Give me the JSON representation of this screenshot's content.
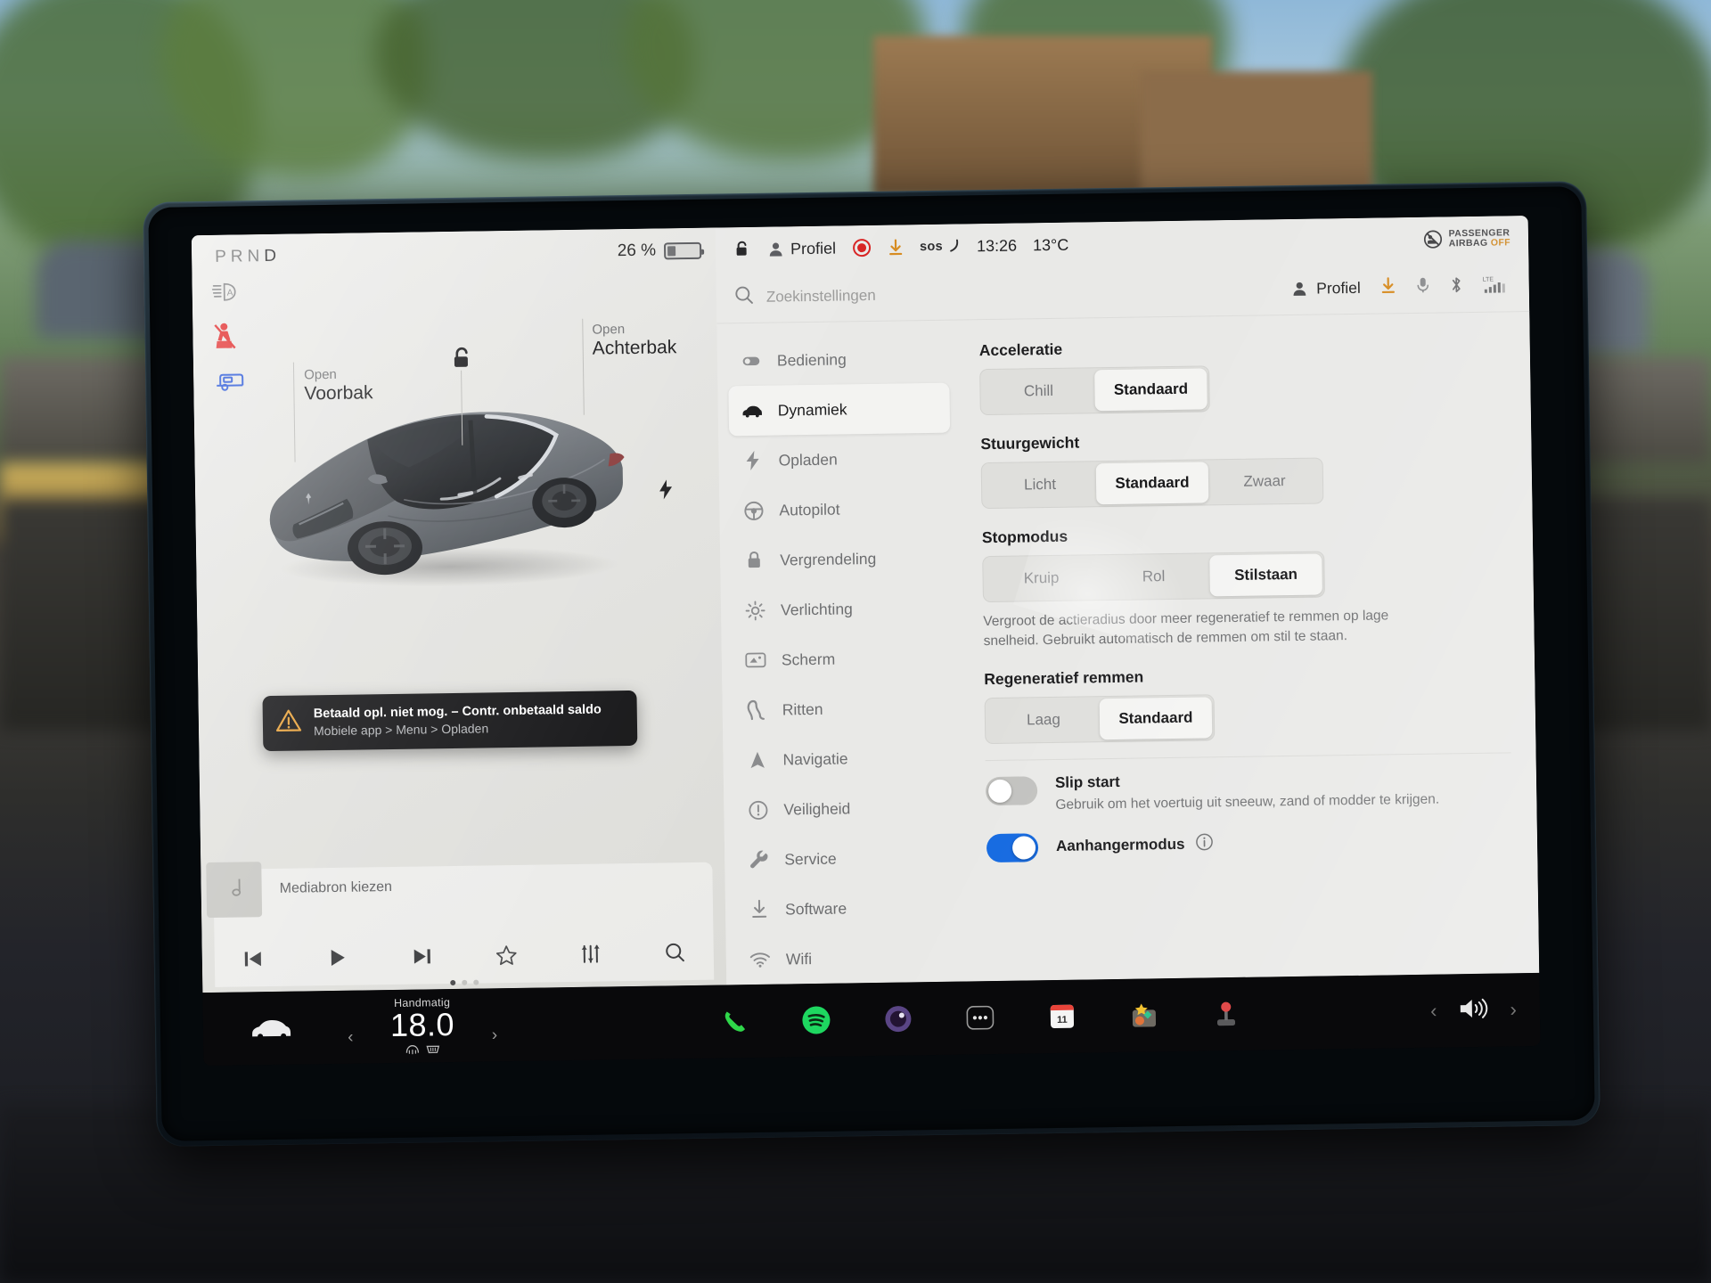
{
  "status_bar_left": {
    "gear_indicator": "PRND",
    "gear_active": "D",
    "battery_percent": "26 %",
    "battery_level": 26
  },
  "status_bar_right": {
    "profile_label": "Profiel",
    "sos_label": "sos",
    "time": "13:26",
    "temperature": "13°C",
    "airbag_line1": "PASSENGER",
    "airbag_line2": "AIRBAG",
    "airbag_state": "OFF",
    "icons": [
      "unlock-icon",
      "person-icon",
      "record-dot-icon",
      "download-icon",
      "sos-icon"
    ]
  },
  "indicators": [
    {
      "name": "auto-high-beam-icon",
      "color": "#7b7c7e"
    },
    {
      "name": "seatbelt-warning-icon",
      "color": "#e02424"
    },
    {
      "name": "trailer-mode-icon",
      "color": "#2756d8"
    }
  ],
  "car_view": {
    "front_trunk": {
      "action": "Open",
      "label": "Voorbak"
    },
    "rear_trunk": {
      "action": "Open",
      "label": "Achterbak"
    },
    "lock_state_icon": "unlock-icon",
    "charge_port_icon": "charge-bolt-icon",
    "car_color": "#6f7478"
  },
  "alert": {
    "icon": "warning-triangle-icon",
    "title": "Betaald opl. niet mog. – Contr. onbetaald saldo",
    "subtitle": "Mobiele app > Menu > Opladen"
  },
  "media_player": {
    "title": "Mediabron kiezen",
    "album_art_icon": "music-note-icon",
    "controls": [
      {
        "name": "previous-track-button",
        "icon": "skip-back-icon"
      },
      {
        "name": "play-button",
        "icon": "play-icon"
      },
      {
        "name": "next-track-button",
        "icon": "skip-forward-icon"
      },
      {
        "name": "favorite-button",
        "icon": "star-icon"
      },
      {
        "name": "equalizer-button",
        "icon": "sliders-icon"
      },
      {
        "name": "search-media-button",
        "icon": "search-icon"
      }
    ],
    "page_dots": 3,
    "active_dot": 0
  },
  "search": {
    "placeholder": "Zoekinstellingen",
    "icon": "search-icon"
  },
  "toolbar": {
    "profile_label": "Profiel",
    "icons": [
      "download-icon",
      "microphone-icon",
      "bluetooth-icon",
      "lte-signal-icon"
    ],
    "network_label": "LTE"
  },
  "menu": {
    "items": [
      {
        "label": "Bediening",
        "icon": "toggle-icon",
        "selected": false
      },
      {
        "label": "Dynamiek",
        "icon": "car-icon",
        "selected": true
      },
      {
        "label": "Opladen",
        "icon": "bolt-icon",
        "selected": false
      },
      {
        "label": "Autopilot",
        "icon": "steering-wheel-icon",
        "selected": false
      },
      {
        "label": "Vergrendeling",
        "icon": "lock-icon",
        "selected": false
      },
      {
        "label": "Verlichting",
        "icon": "sun-icon",
        "selected": false
      },
      {
        "label": "Scherm",
        "icon": "display-icon",
        "selected": false
      },
      {
        "label": "Ritten",
        "icon": "road-icon",
        "selected": false
      },
      {
        "label": "Navigatie",
        "icon": "navigation-arrow-icon",
        "selected": false
      },
      {
        "label": "Veiligheid",
        "icon": "alert-circle-icon",
        "selected": false
      },
      {
        "label": "Service",
        "icon": "wrench-icon",
        "selected": false
      },
      {
        "label": "Software",
        "icon": "download-icon",
        "selected": false
      },
      {
        "label": "Wifi",
        "icon": "wifi-icon",
        "selected": false
      }
    ]
  },
  "settings": {
    "acceleration": {
      "title": "Acceleratie",
      "options": [
        "Chill",
        "Standaard"
      ],
      "selected": "Standaard"
    },
    "steering": {
      "title": "Stuurgewicht",
      "options": [
        "Licht",
        "Standaard",
        "Zwaar"
      ],
      "selected": "Standaard"
    },
    "stop_mode": {
      "title": "Stopmodus",
      "options": [
        "Kruip",
        "Rol",
        "Stilstaan"
      ],
      "selected": "Stilstaan",
      "description": "Vergroot de actieradius door meer regeneratief te remmen op lage snelheid. Gebruikt automatisch de remmen om stil te staan."
    },
    "regen_braking": {
      "title": "Regeneratief remmen",
      "options": [
        "Laag",
        "Standaard"
      ],
      "selected": "Standaard"
    },
    "slip_start": {
      "label": "Slip start",
      "description": "Gebruik om het voertuig uit sneeuw, zand of modder te krijgen.",
      "enabled": false
    },
    "trailer_mode": {
      "label": "Aanhangermodus",
      "info_icon": "info-icon",
      "enabled": true
    }
  },
  "dock": {
    "car_icon": "car-icon",
    "climate_mode": "Handmatig",
    "temperature": "18.0",
    "prev_chevron": "‹",
    "next_chevron": "›",
    "apps": [
      {
        "name": "phone-app-icon",
        "color": "#2fd64a"
      },
      {
        "name": "spotify-app-icon",
        "color": "#1ed760"
      },
      {
        "name": "camera-app-icon",
        "color": "#6b4fa0"
      },
      {
        "name": "more-apps-icon",
        "color": "#d8d8d8"
      },
      {
        "name": "calendar-app-icon",
        "color": "#e8443a",
        "badge": "11"
      },
      {
        "name": "toybox-app-icon",
        "color": "#f2c231"
      },
      {
        "name": "joystick-app-icon",
        "color": "#e04a4a"
      }
    ],
    "volume_icon": "volume-icon",
    "left_chevron": "‹",
    "right_chevron": "›"
  },
  "colors": {
    "accent_blue": "#1268e0",
    "warning_amber": "#e8a33d",
    "alert_red": "#e02424",
    "screen_bg": "#e8e8e6",
    "dock_bg": "#09090b"
  }
}
